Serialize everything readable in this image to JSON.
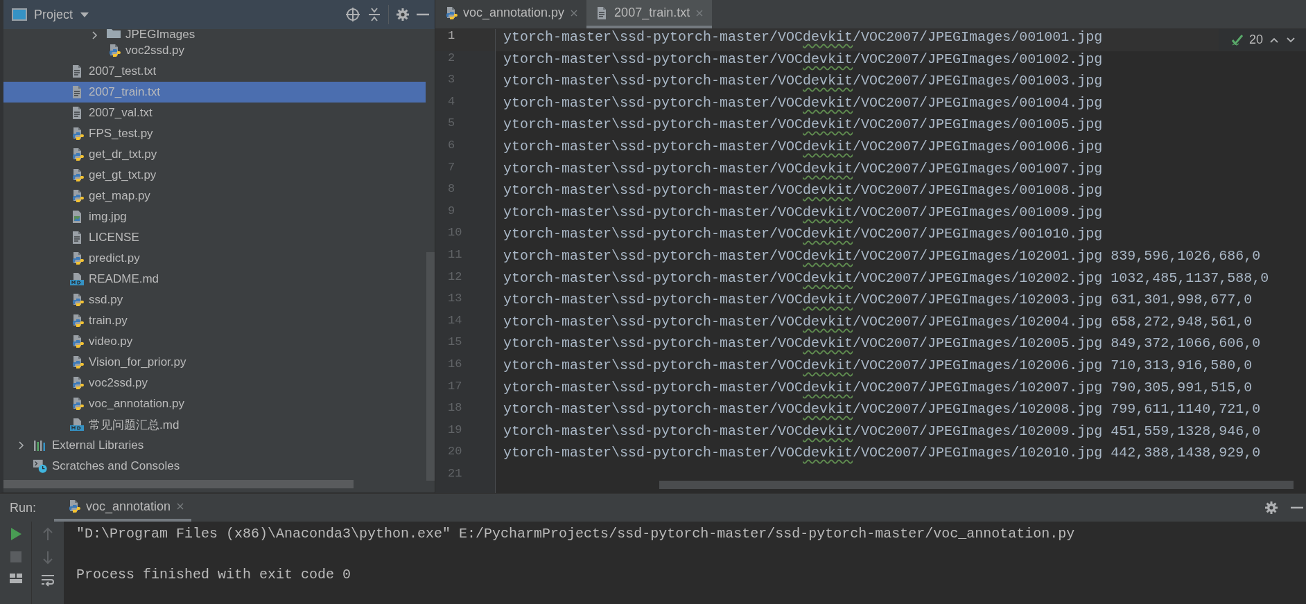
{
  "sidebar": {
    "title": "Project",
    "tree": [
      {
        "children": [
          {
            "children": [
              {
                "children": [
                  {
                    "children": [
                      {
                        "label": "JPEGImages",
                        "kind": "folder",
                        "expanded": false,
                        "selected": false
                      },
                      {
                        "label": "voc2ssd.py",
                        "kind": "python",
                        "selected": false
                      }
                    ]
                  }
                ]
              },
              {
                "label": "2007_test.txt",
                "kind": "text",
                "selected": false
              },
              {
                "label": "2007_train.txt",
                "kind": "text",
                "selected": true
              },
              {
                "label": "2007_val.txt",
                "kind": "text",
                "selected": false
              },
              {
                "label": "FPS_test.py",
                "kind": "python",
                "selected": false
              },
              {
                "label": "get_dr_txt.py",
                "kind": "python",
                "selected": false
              },
              {
                "label": "get_gt_txt.py",
                "kind": "python",
                "selected": false
              },
              {
                "label": "get_map.py",
                "kind": "python",
                "selected": false
              },
              {
                "label": "img.jpg",
                "kind": "image",
                "selected": false
              },
              {
                "label": "LICENSE",
                "kind": "text",
                "selected": false
              },
              {
                "label": "predict.py",
                "kind": "python",
                "selected": false
              },
              {
                "label": "README.md",
                "kind": "markdown",
                "selected": false
              },
              {
                "label": "ssd.py",
                "kind": "python",
                "selected": false
              },
              {
                "label": "train.py",
                "kind": "python",
                "selected": false
              },
              {
                "label": "video.py",
                "kind": "python",
                "selected": false
              },
              {
                "label": "Vision_for_prior.py",
                "kind": "python",
                "selected": false
              },
              {
                "label": "voc2ssd.py",
                "kind": "python",
                "selected": false
              },
              {
                "label": "voc_annotation.py",
                "kind": "python",
                "selected": false
              },
              {
                "label": "常见问题汇总.md",
                "kind": "markdown",
                "selected": false
              }
            ]
          }
        ]
      },
      {
        "label": "External Libraries",
        "kind": "libraries",
        "expanded": false,
        "selected": false
      },
      {
        "label": "Scratches and Consoles",
        "kind": "scratches",
        "selected": false
      }
    ]
  },
  "editor": {
    "tabs": [
      {
        "label": "voc_annotation.py",
        "kind": "python",
        "selected": false
      },
      {
        "label": "2007_train.txt",
        "kind": "text",
        "selected": true
      }
    ],
    "inspection": {
      "count": "20"
    },
    "lines": [
      {
        "number": "1",
        "current": true,
        "before": "ytorch-master\\ssd-pytorch-master/VOC",
        "flagged": "devkit",
        "after": "/VOC2007/JPEGImages/001001.jpg"
      },
      {
        "number": "2",
        "current": false,
        "before": "ytorch-master\\ssd-pytorch-master/VOC",
        "flagged": "devkit",
        "after": "/VOC2007/JPEGImages/001002.jpg"
      },
      {
        "number": "3",
        "current": false,
        "before": "ytorch-master\\ssd-pytorch-master/VOC",
        "flagged": "devkit",
        "after": "/VOC2007/JPEGImages/001003.jpg"
      },
      {
        "number": "4",
        "current": false,
        "before": "ytorch-master\\ssd-pytorch-master/VOC",
        "flagged": "devkit",
        "after": "/VOC2007/JPEGImages/001004.jpg"
      },
      {
        "number": "5",
        "current": false,
        "before": "ytorch-master\\ssd-pytorch-master/VOC",
        "flagged": "devkit",
        "after": "/VOC2007/JPEGImages/001005.jpg"
      },
      {
        "number": "6",
        "current": false,
        "before": "ytorch-master\\ssd-pytorch-master/VOC",
        "flagged": "devkit",
        "after": "/VOC2007/JPEGImages/001006.jpg"
      },
      {
        "number": "7",
        "current": false,
        "before": "ytorch-master\\ssd-pytorch-master/VOC",
        "flagged": "devkit",
        "after": "/VOC2007/JPEGImages/001007.jpg"
      },
      {
        "number": "8",
        "current": false,
        "before": "ytorch-master\\ssd-pytorch-master/VOC",
        "flagged": "devkit",
        "after": "/VOC2007/JPEGImages/001008.jpg"
      },
      {
        "number": "9",
        "current": false,
        "before": "ytorch-master\\ssd-pytorch-master/VOC",
        "flagged": "devkit",
        "after": "/VOC2007/JPEGImages/001009.jpg"
      },
      {
        "number": "10",
        "current": false,
        "before": "ytorch-master\\ssd-pytorch-master/VOC",
        "flagged": "devkit",
        "after": "/VOC2007/JPEGImages/001010.jpg"
      },
      {
        "number": "11",
        "current": false,
        "before": "ytorch-master\\ssd-pytorch-master/VOC",
        "flagged": "devkit",
        "after": "/VOC2007/JPEGImages/102001.jpg 839,596,1026,686,0"
      },
      {
        "number": "12",
        "current": false,
        "before": "ytorch-master\\ssd-pytorch-master/VOC",
        "flagged": "devkit",
        "after": "/VOC2007/JPEGImages/102002.jpg 1032,485,1137,588,0"
      },
      {
        "number": "13",
        "current": false,
        "before": "ytorch-master\\ssd-pytorch-master/VOC",
        "flagged": "devkit",
        "after": "/VOC2007/JPEGImages/102003.jpg 631,301,998,677,0"
      },
      {
        "number": "14",
        "current": false,
        "before": "ytorch-master\\ssd-pytorch-master/VOC",
        "flagged": "devkit",
        "after": "/VOC2007/JPEGImages/102004.jpg 658,272,948,561,0"
      },
      {
        "number": "15",
        "current": false,
        "before": "ytorch-master\\ssd-pytorch-master/VOC",
        "flagged": "devkit",
        "after": "/VOC2007/JPEGImages/102005.jpg 849,372,1066,606,0"
      },
      {
        "number": "16",
        "current": false,
        "before": "ytorch-master\\ssd-pytorch-master/VOC",
        "flagged": "devkit",
        "after": "/VOC2007/JPEGImages/102006.jpg 710,313,916,580,0"
      },
      {
        "number": "17",
        "current": false,
        "before": "ytorch-master\\ssd-pytorch-master/VOC",
        "flagged": "devkit",
        "after": "/VOC2007/JPEGImages/102007.jpg 790,305,991,515,0"
      },
      {
        "number": "18",
        "current": false,
        "before": "ytorch-master\\ssd-pytorch-master/VOC",
        "flagged": "devkit",
        "after": "/VOC2007/JPEGImages/102008.jpg 799,611,1140,721,0"
      },
      {
        "number": "19",
        "current": false,
        "before": "ytorch-master\\ssd-pytorch-master/VOC",
        "flagged": "devkit",
        "after": "/VOC2007/JPEGImages/102009.jpg 451,559,1328,946,0"
      },
      {
        "number": "20",
        "current": false,
        "before": "ytorch-master\\ssd-pytorch-master/VOC",
        "flagged": "devkit",
        "after": "/VOC2007/JPEGImages/102010.jpg 442,388,1438,929,0"
      },
      {
        "number": "21",
        "current": false
      }
    ]
  },
  "run_panel": {
    "label": "Run:",
    "tab": {
      "label": "voc_annotation",
      "kind": "python",
      "selected": true
    },
    "console": [
      "\"D:\\Program Files (x86)\\Anaconda3\\python.exe\" E:/PycharmProjects/ssd-pytorch-master/ssd-pytorch-master/voc_annotation.py",
      "Process finished with exit code 0"
    ]
  }
}
